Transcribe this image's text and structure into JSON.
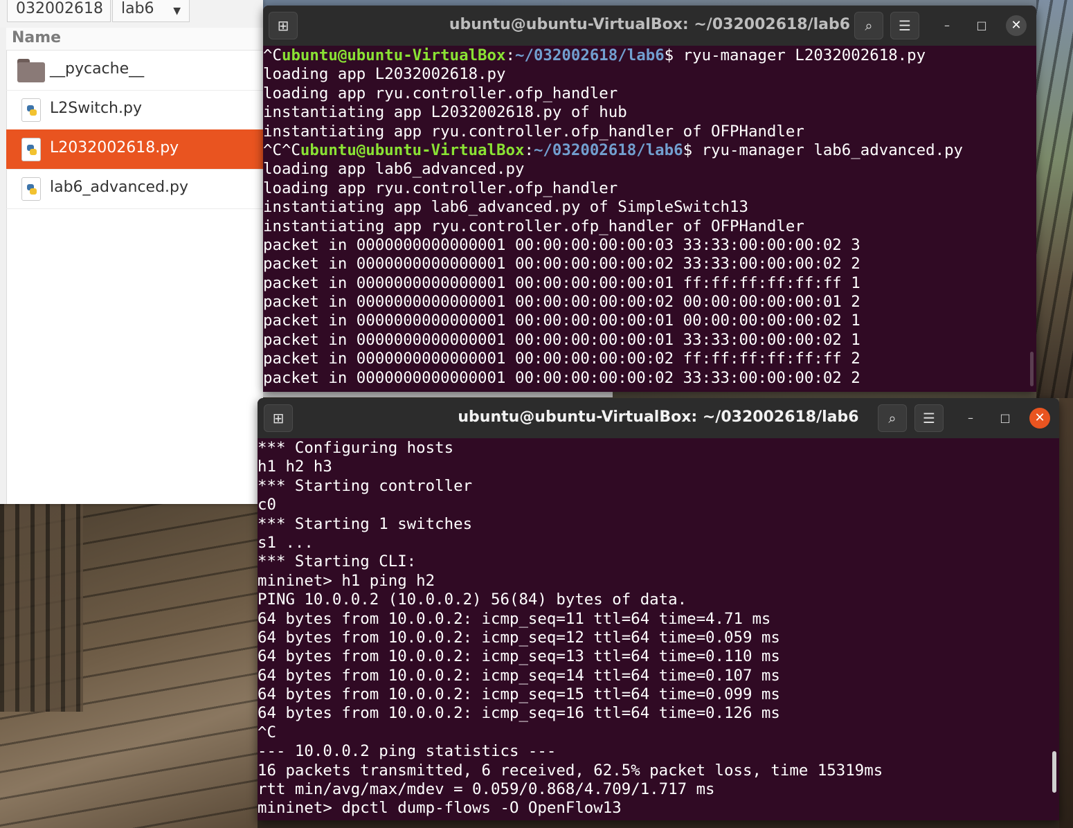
{
  "file_manager": {
    "breadcrumbs": [
      "032002618",
      "lab6"
    ],
    "column_header": "Name",
    "files": [
      {
        "name": "__pycache__",
        "type": "folder",
        "selected": false
      },
      {
        "name": "L2Switch.py",
        "type": "python",
        "selected": false
      },
      {
        "name": "L2032002618.py",
        "type": "python",
        "selected": true
      },
      {
        "name": "lab6_advanced.py",
        "type": "python",
        "selected": false
      }
    ],
    "selected_color": "#e95420"
  },
  "terminal_top": {
    "title": "ubuntu@ubuntu-VirtualBox: ~/032002618/lab6",
    "lines": [
      {
        "pre": "^C",
        "user": "ubuntu@ubuntu-VirtualBox",
        "path": "~/032002618/lab6",
        "cmd": "$ ryu-manager L2032002618.py"
      },
      {
        "text": "loading app L2032002618.py"
      },
      {
        "text": "loading app ryu.controller.ofp_handler"
      },
      {
        "text": "instantiating app L2032002618.py of hub"
      },
      {
        "text": "instantiating app ryu.controller.ofp_handler of OFPHandler"
      },
      {
        "pre": "^C^C",
        "user": "ubuntu@ubuntu-VirtualBox",
        "path": "~/032002618/lab6",
        "cmd": "$ ryu-manager lab6_advanced.py"
      },
      {
        "text": "loading app lab6_advanced.py"
      },
      {
        "text": "loading app ryu.controller.ofp_handler"
      },
      {
        "text": "instantiating app lab6_advanced.py of SimpleSwitch13"
      },
      {
        "text": "instantiating app ryu.controller.ofp_handler of OFPHandler"
      },
      {
        "text": "packet in 0000000000000001 00:00:00:00:00:03 33:33:00:00:00:02 3"
      },
      {
        "text": "packet in 0000000000000001 00:00:00:00:00:02 33:33:00:00:00:02 2"
      },
      {
        "text": "packet in 0000000000000001 00:00:00:00:00:01 ff:ff:ff:ff:ff:ff 1"
      },
      {
        "text": "packet in 0000000000000001 00:00:00:00:00:02 00:00:00:00:00:01 2"
      },
      {
        "text": "packet in 0000000000000001 00:00:00:00:00:01 00:00:00:00:00:02 1"
      },
      {
        "text": "packet in 0000000000000001 00:00:00:00:00:01 33:33:00:00:00:02 1"
      },
      {
        "text": "packet in 0000000000000001 00:00:00:00:00:02 ff:ff:ff:ff:ff:ff 2"
      },
      {
        "text": "packet in 0000000000000001 00:00:00:00:00:02 33:33:00:00:00:02 2"
      }
    ]
  },
  "terminal_bottom": {
    "title": "ubuntu@ubuntu-VirtualBox: ~/032002618/lab6",
    "lines": [
      "*** Configuring hosts",
      "h1 h2 h3",
      "*** Starting controller",
      "c0",
      "*** Starting 1 switches",
      "s1 ...",
      "*** Starting CLI:",
      "mininet> h1 ping h2",
      "PING 10.0.0.2 (10.0.0.2) 56(84) bytes of data.",
      "64 bytes from 10.0.0.2: icmp_seq=11 ttl=64 time=4.71 ms",
      "64 bytes from 10.0.0.2: icmp_seq=12 ttl=64 time=0.059 ms",
      "64 bytes from 10.0.0.2: icmp_seq=13 ttl=64 time=0.110 ms",
      "64 bytes from 10.0.0.2: icmp_seq=14 ttl=64 time=0.107 ms",
      "64 bytes from 10.0.0.2: icmp_seq=15 ttl=64 time=0.099 ms",
      "64 bytes from 10.0.0.2: icmp_seq=16 ttl=64 time=0.126 ms",
      "^C",
      "--- 10.0.0.2 ping statistics ---",
      "16 packets transmitted, 6 received, 62.5% packet loss, time 15319ms",
      "rtt min/avg/max/mdev = 0.059/0.868/4.709/1.717 ms",
      "mininet> dpctl dump-flows -O OpenFlow13"
    ]
  },
  "icons": {
    "new_tab": "new-tab-icon",
    "search": "search-icon",
    "menu": "hamburger-menu-icon",
    "minimize": "minimize-icon",
    "maximize": "maximize-icon",
    "close": "close-icon"
  },
  "colors": {
    "terminal_bg": "#300a24",
    "prompt_user": "#8ae234",
    "prompt_path": "#729fcf",
    "accent": "#e95420"
  }
}
